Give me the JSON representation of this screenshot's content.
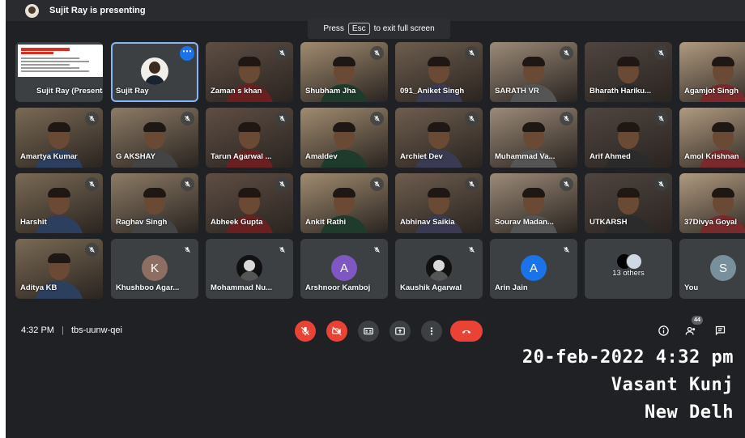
{
  "presenting": {
    "text": "Sujit Ray is presenting"
  },
  "esc_hint": {
    "press": "Press",
    "key": "Esc",
    "rest": "to exit full screen"
  },
  "tiles": [
    {
      "name": "Sujit Ray (Presentation)",
      "type": "presentation"
    },
    {
      "name": "Sujit Ray",
      "type": "highlight"
    },
    {
      "name": "Zaman s khan",
      "type": "photo",
      "muted": true
    },
    {
      "name": "Shubham Jha",
      "type": "photo",
      "muted": true
    },
    {
      "name": "091_Aniket Singh",
      "type": "photo",
      "muted": true
    },
    {
      "name": "SARATH VR",
      "type": "photo",
      "muted": true
    },
    {
      "name": "Bharath Hariku...",
      "type": "photo",
      "muted": true
    },
    {
      "name": "Agamjot Singh",
      "type": "photo",
      "muted": true
    },
    {
      "name": "Amartya Kumar",
      "type": "photo",
      "muted": true
    },
    {
      "name": "G AKSHAY",
      "type": "photo",
      "muted": true
    },
    {
      "name": "Tarun Agarwal ...",
      "type": "photo",
      "muted": true
    },
    {
      "name": "Amaldev",
      "type": "photo",
      "muted": true
    },
    {
      "name": "Archiet Dev",
      "type": "photo",
      "muted": true
    },
    {
      "name": "Muhammad Va...",
      "type": "photo",
      "muted": true
    },
    {
      "name": "Arif Ahmed",
      "type": "photo",
      "muted": true
    },
    {
      "name": "Amol Krishnan",
      "type": "photo",
      "muted": true
    },
    {
      "name": "Harshit",
      "type": "photo",
      "muted": true
    },
    {
      "name": "Raghav Singh",
      "type": "photo",
      "muted": true
    },
    {
      "name": "Abheek Gupta",
      "type": "photo",
      "muted": true
    },
    {
      "name": "Ankit Rathi",
      "type": "photo",
      "muted": true
    },
    {
      "name": "Abhinav Saikia",
      "type": "photo",
      "muted": true
    },
    {
      "name": "Sourav Madan...",
      "type": "photo",
      "muted": true
    },
    {
      "name": "UTKARSH",
      "type": "photo",
      "muted": true
    },
    {
      "name": "37Divya Goyal",
      "type": "photo",
      "muted": true
    },
    {
      "name": "Aditya KB",
      "type": "photo",
      "muted": true
    },
    {
      "name": "Khushboo Agar...",
      "type": "letter",
      "letter": "K",
      "muted": true
    },
    {
      "name": "Mohammad Nu...",
      "type": "avatar",
      "muted": true
    },
    {
      "name": "Arshnoor Kamboj",
      "type": "letter",
      "letter": "A",
      "muted": true
    },
    {
      "name": "Kaushik Agarwal",
      "type": "avatar",
      "muted": true
    },
    {
      "name": "Arin Jain",
      "type": "letter",
      "letter": "A",
      "muted": true
    },
    {
      "name": "13 others",
      "type": "others"
    },
    {
      "name": "You",
      "type": "letter",
      "letter": "S"
    }
  ],
  "colors": {
    "letter_K": "#8d6e63",
    "letter_A_purple": "#7e57c2",
    "letter_A_blue": "#1a73e8",
    "letter_S": "#78909c",
    "accent_red": "#ea4335",
    "highlight_border": "#8ab4f8"
  },
  "toolbar": {
    "time": "4:32 PM",
    "separator": "|",
    "meeting_code": "tbs-uunw-qei",
    "people_count": "44"
  },
  "overlay": {
    "line1": "20-feb-2022 4:32 pm",
    "line2": "Vasant Kunj",
    "line3": "New Delh"
  }
}
